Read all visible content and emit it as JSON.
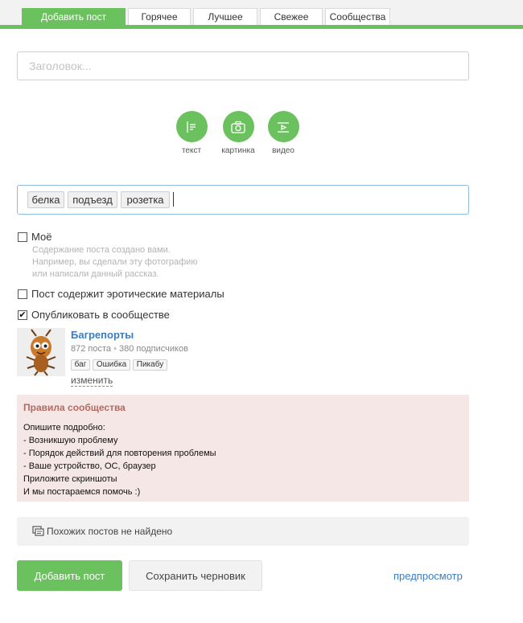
{
  "colors": {
    "accent": "#6cc15f",
    "link": "#3b7dbf",
    "rules_bg": "#f5e7e5",
    "rules_title": "#b26a63"
  },
  "nav": {
    "tabs": [
      {
        "label": "Добавить пост",
        "active": true
      },
      {
        "label": "Горячее"
      },
      {
        "label": "Лучшее"
      },
      {
        "label": "Свежее"
      },
      {
        "label": "Сообщества"
      }
    ]
  },
  "post": {
    "title_placeholder": "Заголовок...",
    "title_value": ""
  },
  "add_buttons": [
    {
      "label": "текст",
      "icon": "text-icon"
    },
    {
      "label": "картинка",
      "icon": "camera-icon"
    },
    {
      "label": "видео",
      "icon": "video-icon"
    }
  ],
  "tags": [
    "белка",
    "подъезд",
    "розетка"
  ],
  "options": {
    "mine": {
      "label": "Моё",
      "checked": false,
      "hint": [
        "Содержание поста создано вами.",
        "Например, вы сделали эту фотографию",
        "или написали данный рассказ."
      ]
    },
    "erotic": {
      "label": "Пост содержит эротические материалы",
      "checked": false
    },
    "community": {
      "label": "Опубликовать в сообществе",
      "checked": true
    }
  },
  "community": {
    "name": "Багрепорты",
    "posts": "872 поста",
    "separator": "•",
    "subscribers": "380 подписчиков",
    "tags": [
      "баг",
      "Ошибка",
      "Пикабу"
    ],
    "change_label": "изменить"
  },
  "rules": {
    "title": "Правила сообщества",
    "lines": [
      "Опишите подробно:",
      "- Возникшую проблему",
      "- Порядок действий для повторения проблемы",
      "- Ваше устройство, ОС, браузер",
      "Приложите скриншоты",
      "И мы постараемся помочь :)"
    ]
  },
  "similar": {
    "text": "Похожих постов не найдено",
    "icon": "posts-icon"
  },
  "actions": {
    "publish_label": "Добавить пост",
    "draft_label": "Сохранить черновик",
    "preview_label": "предпросмотр"
  }
}
